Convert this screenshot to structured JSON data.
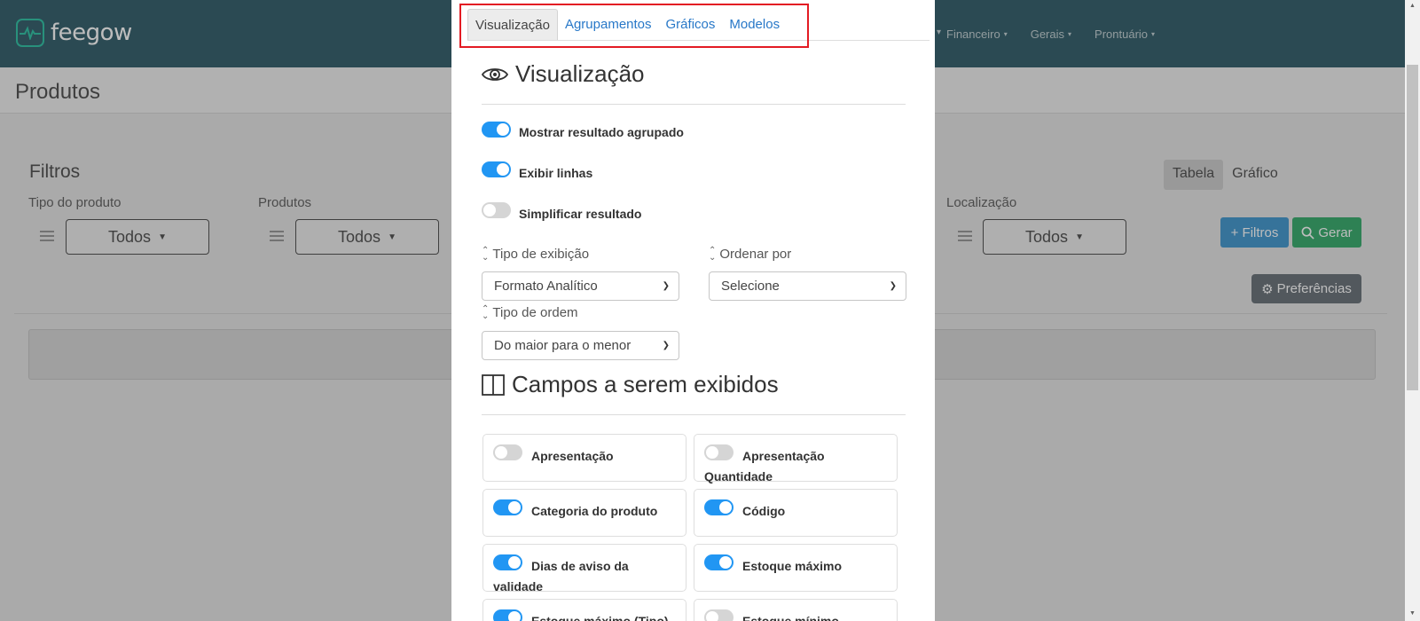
{
  "app": {
    "logo_text": "feegow"
  },
  "topnav": [
    {
      "label": "Financeiro"
    },
    {
      "label": "Gerais"
    },
    {
      "label": "Prontuário"
    }
  ],
  "page": {
    "title": "Produtos"
  },
  "filters": {
    "title": "Filtros",
    "fields": [
      {
        "label": "Tipo do produto",
        "value": "Todos"
      },
      {
        "label": "Produtos",
        "value": "Todos"
      },
      {
        "label": "Localização",
        "value": "Todos"
      }
    ],
    "view_toggle": {
      "tabela": "Tabela",
      "grafico": "Gráfico"
    },
    "add_filters": "+ Filtros",
    "generate": "Gerar",
    "preferences": "Preferências"
  },
  "modal": {
    "tabs": [
      {
        "label": "Visualização"
      },
      {
        "label": "Agrupamentos"
      },
      {
        "label": "Gráficos"
      },
      {
        "label": "Modelos"
      }
    ],
    "visualizacao": {
      "title": "Visualização",
      "options": [
        {
          "label": "Mostrar resultado agrupado",
          "on": true
        },
        {
          "label": "Exibir linhas",
          "on": true
        },
        {
          "label": "Simplificar resultado",
          "on": false
        }
      ],
      "tipo_exibicao": {
        "label": "Tipo de exibição",
        "value": "Formato Analítico"
      },
      "ordenar_por": {
        "label": "Ordenar por",
        "value": "Selecione"
      },
      "tipo_ordem": {
        "label": "Tipo de ordem",
        "value": "Do maior para o menor"
      }
    },
    "campos": {
      "title": "Campos a serem exibidos",
      "items": [
        {
          "label": "Apresentação",
          "on": false
        },
        {
          "label": "Apresentação Quantidade",
          "on": false
        },
        {
          "label": "Categoria do produto",
          "on": true
        },
        {
          "label": "Código",
          "on": true
        },
        {
          "label": "Dias de aviso da validade",
          "on": true
        },
        {
          "label": "Estoque máximo",
          "on": true
        },
        {
          "label": "Estoque máximo (Tipo)",
          "on": true
        },
        {
          "label": "Estoque mínimo",
          "on": false
        }
      ]
    }
  },
  "colors": {
    "topbar": "#3b6470",
    "accent": "#2196f3",
    "highlight": "#e31b23",
    "link": "#2878c8"
  }
}
